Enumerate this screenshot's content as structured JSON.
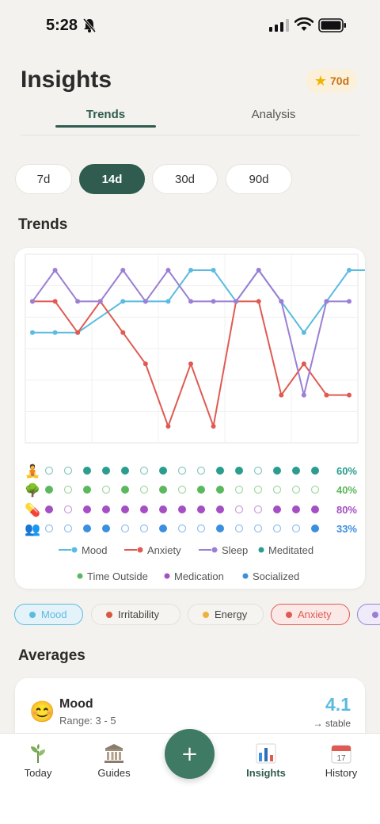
{
  "status": {
    "time": "5:28"
  },
  "header": {
    "title": "Insights",
    "streak": "70d"
  },
  "tabs": [
    {
      "label": "Trends",
      "active": true
    },
    {
      "label": "Analysis",
      "active": false
    }
  ],
  "ranges": [
    {
      "label": "7d",
      "active": false
    },
    {
      "label": "14d",
      "active": true
    },
    {
      "label": "30d",
      "active": false
    },
    {
      "label": "90d",
      "active": false
    }
  ],
  "trends_section": {
    "title": "Trends"
  },
  "chart_data": {
    "type": "line",
    "x": [
      1,
      2,
      3,
      4,
      5,
      6,
      7,
      8,
      9,
      10,
      11,
      12,
      13,
      14,
      15,
      16,
      17,
      18
    ],
    "series": [
      {
        "name": "Mood",
        "color": "#5bbbe0",
        "values": [
          3,
          3,
          3,
          null,
          4,
          4,
          4,
          null,
          5,
          5,
          4,
          5,
          4,
          3,
          4,
          5,
          5,
          null
        ],
        "points": [
          [
            0,
            3
          ],
          [
            1,
            3
          ],
          [
            2,
            3
          ],
          [
            4,
            4
          ],
          [
            5,
            4
          ],
          [
            6,
            4
          ],
          [
            7,
            5
          ],
          [
            8,
            5
          ],
          [
            9,
            4
          ],
          [
            10,
            5
          ],
          [
            11,
            4
          ],
          [
            12,
            3
          ],
          [
            13,
            4
          ],
          [
            14,
            5
          ],
          [
            15,
            5
          ]
        ]
      },
      {
        "name": "Anxiety",
        "color": "#e05a52",
        "points": [
          [
            0,
            4
          ],
          [
            1,
            4
          ],
          [
            2,
            3
          ],
          [
            3,
            4
          ],
          [
            4,
            3
          ],
          [
            5,
            2
          ],
          [
            6,
            0
          ],
          [
            7,
            2
          ],
          [
            8,
            0
          ],
          [
            9,
            4
          ],
          [
            10,
            4
          ],
          [
            11,
            1
          ],
          [
            12,
            2
          ],
          [
            13,
            1
          ],
          [
            14,
            1
          ]
        ]
      },
      {
        "name": "Sleep",
        "color": "#9b7fd4",
        "points": [
          [
            0,
            4
          ],
          [
            1,
            5
          ],
          [
            2,
            4
          ],
          [
            3,
            4
          ],
          [
            4,
            5
          ],
          [
            5,
            4
          ],
          [
            6,
            5
          ],
          [
            7,
            4
          ],
          [
            8,
            4
          ],
          [
            9,
            4
          ],
          [
            10,
            5
          ],
          [
            11,
            4
          ],
          [
            12,
            1
          ],
          [
            13,
            4
          ],
          [
            14,
            4
          ]
        ]
      }
    ],
    "habits": [
      {
        "name": "Meditated",
        "icon": "meditate-icon",
        "color": "#2a9d8f",
        "percent": "60%",
        "days": [
          0,
          0,
          1,
          1,
          1,
          0,
          1,
          0,
          0,
          1,
          1,
          0,
          1,
          1,
          1
        ]
      },
      {
        "name": "Time Outside",
        "icon": "tree-icon",
        "color": "#5cb85c",
        "percent": "40%",
        "days": [
          1,
          0,
          1,
          0,
          1,
          0,
          1,
          0,
          1,
          1,
          0,
          0,
          0,
          0,
          0
        ]
      },
      {
        "name": "Medication",
        "icon": "pill-icon",
        "color": "#a44fc3",
        "percent": "80%",
        "days": [
          1,
          0,
          1,
          1,
          1,
          1,
          1,
          1,
          1,
          1,
          0,
          0,
          1,
          1,
          1
        ]
      },
      {
        "name": "Socialized",
        "icon": "people-icon",
        "color": "#3b8fe0",
        "percent": "33%",
        "days": [
          0,
          0,
          1,
          1,
          0,
          0,
          1,
          0,
          0,
          1,
          0,
          0,
          0,
          0,
          1
        ]
      }
    ],
    "legend": [
      {
        "name": "Mood",
        "color": "#5bbbe0",
        "style": "line"
      },
      {
        "name": "Anxiety",
        "color": "#e05a52",
        "style": "line"
      },
      {
        "name": "Sleep",
        "color": "#9b7fd4",
        "style": "line"
      },
      {
        "name": "Meditated",
        "color": "#2a9d8f",
        "style": "dot"
      },
      {
        "name": "Time Outside",
        "color": "#5cb85c",
        "style": "dot"
      },
      {
        "name": "Medication",
        "color": "#a44fc3",
        "style": "dot"
      },
      {
        "name": "Socialized",
        "color": "#3b8fe0",
        "style": "dot"
      }
    ],
    "ylim": [
      0,
      5
    ],
    "grid": true
  },
  "filters": [
    {
      "label": "Mood",
      "color": "#5bbbe0",
      "active": true
    },
    {
      "label": "Irritability",
      "color": "#d9573f",
      "active": false
    },
    {
      "label": "Energy",
      "color": "#f0b040",
      "active": false
    },
    {
      "label": "Anxiety",
      "color": "#e05a52",
      "active": true
    },
    {
      "label": "",
      "color": "#9b7fd4",
      "active": true
    }
  ],
  "averages": {
    "title": "Averages",
    "items": [
      {
        "name": "Mood",
        "icon": "smile-icon",
        "range": "Range: 3 - 5",
        "value": "4.1",
        "trend": "→ stable"
      }
    ]
  },
  "nav": [
    {
      "label": "Today",
      "icon": "sprout-icon",
      "active": false
    },
    {
      "label": "Guides",
      "icon": "temple-icon",
      "active": false
    },
    {
      "label": "Insights",
      "icon": "bar-chart-icon",
      "active": true
    },
    {
      "label": "History",
      "icon": "calendar-icon",
      "active": false
    }
  ],
  "fab": {
    "label": "+"
  }
}
